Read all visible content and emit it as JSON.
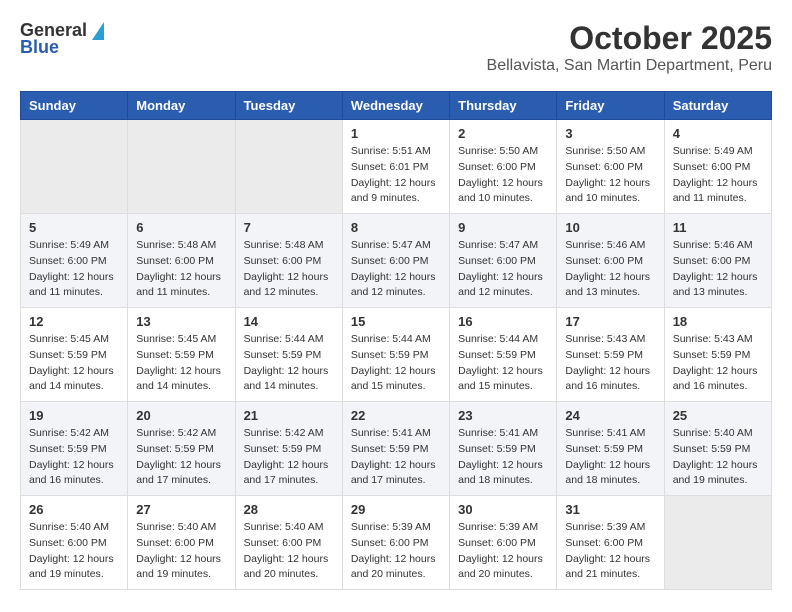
{
  "header": {
    "logo": {
      "line1": "General",
      "line2": "Blue"
    },
    "title": "October 2025",
    "subtitle": "Bellavista, San Martin Department, Peru"
  },
  "weekdays": [
    "Sunday",
    "Monday",
    "Tuesday",
    "Wednesday",
    "Thursday",
    "Friday",
    "Saturday"
  ],
  "weeks": [
    [
      {
        "day": null,
        "info": null
      },
      {
        "day": null,
        "info": null
      },
      {
        "day": null,
        "info": null
      },
      {
        "day": "1",
        "info": "Sunrise: 5:51 AM\nSunset: 6:01 PM\nDaylight: 12 hours and 9 minutes."
      },
      {
        "day": "2",
        "info": "Sunrise: 5:50 AM\nSunset: 6:00 PM\nDaylight: 12 hours and 10 minutes."
      },
      {
        "day": "3",
        "info": "Sunrise: 5:50 AM\nSunset: 6:00 PM\nDaylight: 12 hours and 10 minutes."
      },
      {
        "day": "4",
        "info": "Sunrise: 5:49 AM\nSunset: 6:00 PM\nDaylight: 12 hours and 11 minutes."
      }
    ],
    [
      {
        "day": "5",
        "info": "Sunrise: 5:49 AM\nSunset: 6:00 PM\nDaylight: 12 hours and 11 minutes."
      },
      {
        "day": "6",
        "info": "Sunrise: 5:48 AM\nSunset: 6:00 PM\nDaylight: 12 hours and 11 minutes."
      },
      {
        "day": "7",
        "info": "Sunrise: 5:48 AM\nSunset: 6:00 PM\nDaylight: 12 hours and 12 minutes."
      },
      {
        "day": "8",
        "info": "Sunrise: 5:47 AM\nSunset: 6:00 PM\nDaylight: 12 hours and 12 minutes."
      },
      {
        "day": "9",
        "info": "Sunrise: 5:47 AM\nSunset: 6:00 PM\nDaylight: 12 hours and 12 minutes."
      },
      {
        "day": "10",
        "info": "Sunrise: 5:46 AM\nSunset: 6:00 PM\nDaylight: 12 hours and 13 minutes."
      },
      {
        "day": "11",
        "info": "Sunrise: 5:46 AM\nSunset: 6:00 PM\nDaylight: 12 hours and 13 minutes."
      }
    ],
    [
      {
        "day": "12",
        "info": "Sunrise: 5:45 AM\nSunset: 5:59 PM\nDaylight: 12 hours and 14 minutes."
      },
      {
        "day": "13",
        "info": "Sunrise: 5:45 AM\nSunset: 5:59 PM\nDaylight: 12 hours and 14 minutes."
      },
      {
        "day": "14",
        "info": "Sunrise: 5:44 AM\nSunset: 5:59 PM\nDaylight: 12 hours and 14 minutes."
      },
      {
        "day": "15",
        "info": "Sunrise: 5:44 AM\nSunset: 5:59 PM\nDaylight: 12 hours and 15 minutes."
      },
      {
        "day": "16",
        "info": "Sunrise: 5:44 AM\nSunset: 5:59 PM\nDaylight: 12 hours and 15 minutes."
      },
      {
        "day": "17",
        "info": "Sunrise: 5:43 AM\nSunset: 5:59 PM\nDaylight: 12 hours and 16 minutes."
      },
      {
        "day": "18",
        "info": "Sunrise: 5:43 AM\nSunset: 5:59 PM\nDaylight: 12 hours and 16 minutes."
      }
    ],
    [
      {
        "day": "19",
        "info": "Sunrise: 5:42 AM\nSunset: 5:59 PM\nDaylight: 12 hours and 16 minutes."
      },
      {
        "day": "20",
        "info": "Sunrise: 5:42 AM\nSunset: 5:59 PM\nDaylight: 12 hours and 17 minutes."
      },
      {
        "day": "21",
        "info": "Sunrise: 5:42 AM\nSunset: 5:59 PM\nDaylight: 12 hours and 17 minutes."
      },
      {
        "day": "22",
        "info": "Sunrise: 5:41 AM\nSunset: 5:59 PM\nDaylight: 12 hours and 17 minutes."
      },
      {
        "day": "23",
        "info": "Sunrise: 5:41 AM\nSunset: 5:59 PM\nDaylight: 12 hours and 18 minutes."
      },
      {
        "day": "24",
        "info": "Sunrise: 5:41 AM\nSunset: 5:59 PM\nDaylight: 12 hours and 18 minutes."
      },
      {
        "day": "25",
        "info": "Sunrise: 5:40 AM\nSunset: 5:59 PM\nDaylight: 12 hours and 19 minutes."
      }
    ],
    [
      {
        "day": "26",
        "info": "Sunrise: 5:40 AM\nSunset: 6:00 PM\nDaylight: 12 hours and 19 minutes."
      },
      {
        "day": "27",
        "info": "Sunrise: 5:40 AM\nSunset: 6:00 PM\nDaylight: 12 hours and 19 minutes."
      },
      {
        "day": "28",
        "info": "Sunrise: 5:40 AM\nSunset: 6:00 PM\nDaylight: 12 hours and 20 minutes."
      },
      {
        "day": "29",
        "info": "Sunrise: 5:39 AM\nSunset: 6:00 PM\nDaylight: 12 hours and 20 minutes."
      },
      {
        "day": "30",
        "info": "Sunrise: 5:39 AM\nSunset: 6:00 PM\nDaylight: 12 hours and 20 minutes."
      },
      {
        "day": "31",
        "info": "Sunrise: 5:39 AM\nSunset: 6:00 PM\nDaylight: 12 hours and 21 minutes."
      },
      {
        "day": null,
        "info": null
      }
    ]
  ]
}
